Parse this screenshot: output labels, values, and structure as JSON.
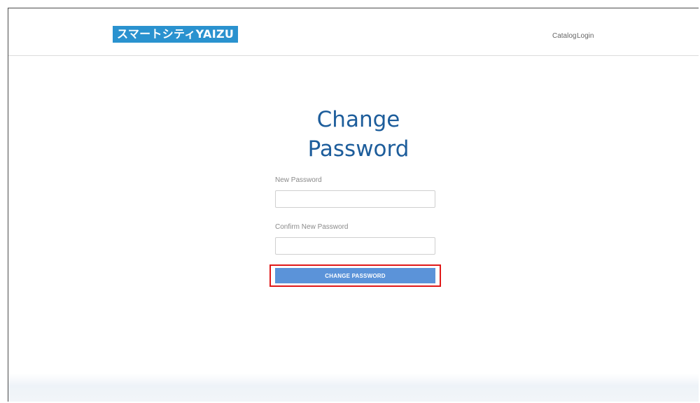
{
  "header": {
    "logo_text": "スマートシティYAIZU",
    "nav": {
      "catalog": "Catalog",
      "login": "Login"
    }
  },
  "form": {
    "title_line1": "Change",
    "title_line2": "Password",
    "new_password_label": "New Password",
    "new_password_value": "",
    "confirm_password_label": "Confirm New Password",
    "confirm_password_value": "",
    "submit_label": "CHANGE PASSWORD"
  },
  "colors": {
    "brand": "#2a92cf",
    "title": "#1d5d9b",
    "button": "#5b93d9",
    "highlight": "#e01818"
  }
}
